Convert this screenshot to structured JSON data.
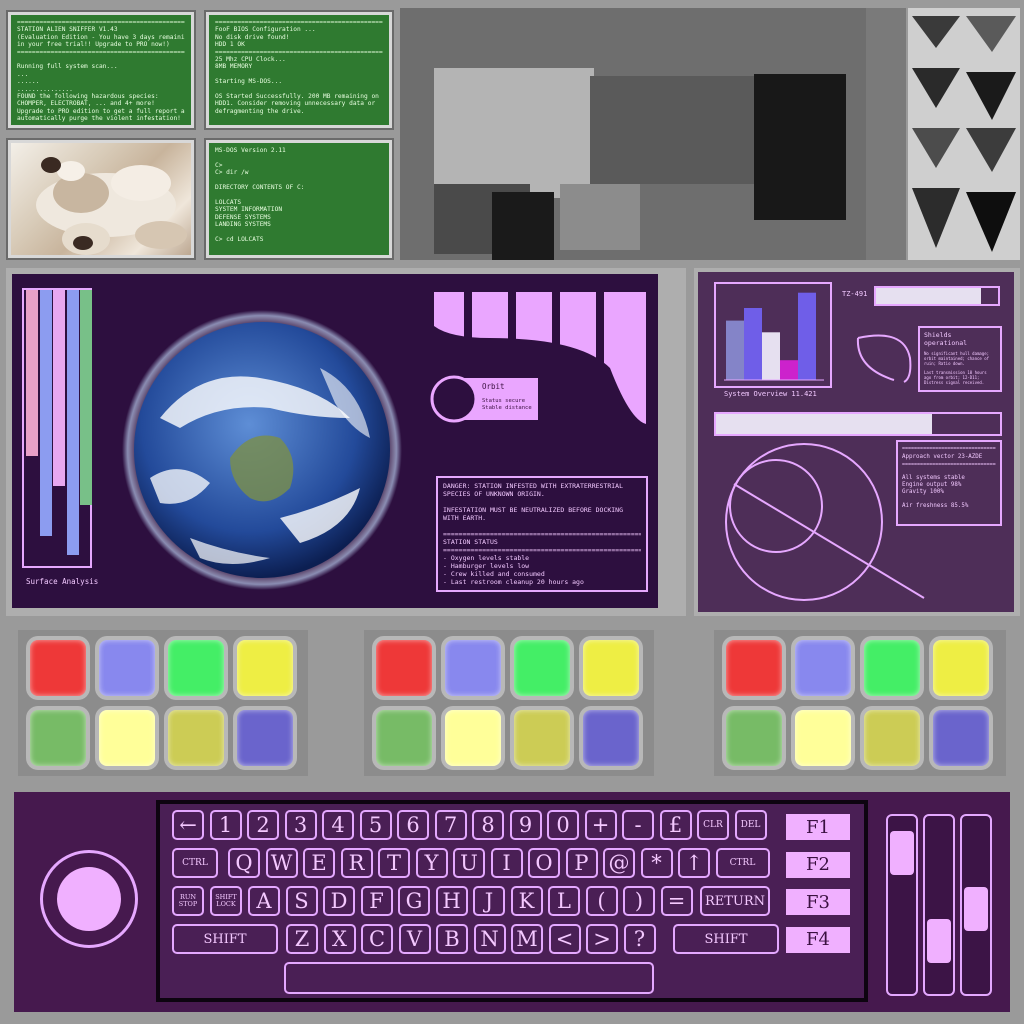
{
  "terminals": {
    "alien": {
      "lines": [
        "===================================================",
        "STATION ALIEN SNIFFER V1.43",
        "(Evaluation Edition - You have 3 days remaining",
        "in your free trial!! Upgrade to PRO now!)",
        "===================================================",
        "",
        "Running full system scan...",
        "...",
        "......",
        "...............",
        "FOUND the following hazardous species:",
        "CHOMPER, ELECTROBAT, ... and 4+ more!",
        "Upgrade to PRO edition to get a full report and",
        "automatically purge the violent infestation!"
      ]
    },
    "bios": {
      "lines": [
        "===================================================",
        "FooF BIOS Configuration ...",
        "No disk drive found!",
        "HDD 1 OK",
        "===================================================",
        "25 Mhz CPU Clock...",
        "8MB MEMORY",
        "",
        "Starting MS-DOS...",
        "",
        "OS Started Successfully. 200 MB remaining on",
        "HDD1. Consider removing unnecessary data or",
        "defragmenting the drive."
      ]
    },
    "dos": {
      "lines": [
        "MS-DOS Version 2.11",
        "",
        "C>",
        "C> dir /w",
        "",
        "DIRECTORY CONTENTS OF C:",
        "",
        "LOLCATS",
        "SYSTEM INFORMATION",
        "DEFENSE SYSTEMS",
        "LANDING SYSTEMS",
        "",
        "C> cd LOLCATS"
      ]
    }
  },
  "surface": {
    "label": "Surface Analysis",
    "bars": [
      {
        "color": "#e8a0c8",
        "level": 0.6
      },
      {
        "color": "#8c9cf0",
        "level": 0.89
      },
      {
        "color": "#e8a8f0",
        "level": 0.71
      },
      {
        "color": "#8c9cf0",
        "level": 0.96
      },
      {
        "color": "#78c088",
        "level": 0.78
      }
    ]
  },
  "orbit": {
    "title": "Orbit",
    "line1": "Status secure",
    "line2": "Stable distance"
  },
  "danger": {
    "line1": "DANGER: STATION INFESTED WITH EXTRATERRESTRIAL",
    "line2": "SPECIES OF UNKNOWN ORIGIN.",
    "line3": "INFESTATION MUST BE NEUTRALIZED BEFORE DOCKING",
    "line4": "WITH EARTH.",
    "sep": "===================================================",
    "status_title": "STATION STATUS",
    "items": [
      "- Oxygen levels stable",
      "- Hamburger levels low",
      "- Crew killed and consumed",
      "- Last restroom cleanup 20 hours ago"
    ]
  },
  "sidepanel": {
    "chart_caption": "System Overview 11.421",
    "tz_label": "TZ-491",
    "tz_level": 0.86,
    "wide_bar_level": 0.76,
    "shields_title": "Shields operational",
    "shields_text1": "No significant hull damage; orbit maintained; chance of ruin; Ratio down.",
    "shields_text2": "Last transmission 10 hours ago from orbit; 12-D11; Distress signal received.",
    "sep": "================================",
    "approach": "Approach vector 23-AZDE",
    "status_lines": [
      "All systems stable",
      "Engine output 98%",
      "Gravity 100%",
      "",
      "Air freshness 85.5%"
    ]
  },
  "overview_chart": {
    "type": "bar",
    "values": [
      0.66,
      0.8,
      0.53,
      0.22,
      0.97
    ],
    "colors": [
      "#8484c8",
      "#6f5ee8",
      "#e6e0f0",
      "#cc22cc",
      "#6f5ee8"
    ]
  },
  "pads": [
    {
      "colors": [
        "#ee3838",
        "#8888ee",
        "#44ee66",
        "#eeee44",
        "#77bb66",
        "#ffff99",
        "#cccc55",
        "#6a64cc"
      ]
    },
    {
      "colors": [
        "#ee3838",
        "#8888ee",
        "#44ee66",
        "#eeee44",
        "#77bb66",
        "#ffff99",
        "#cccc55",
        "#6a64cc"
      ]
    },
    {
      "colors": [
        "#ee3838",
        "#8888ee",
        "#44ee66",
        "#eeee44",
        "#77bb66",
        "#ffff99",
        "#cccc55",
        "#6a64cc"
      ]
    }
  ],
  "keyboard": {
    "row1": [
      "←",
      "1",
      "2",
      "3",
      "4",
      "5",
      "6",
      "7",
      "8",
      "9",
      "0",
      "+",
      "-",
      "£",
      "CLR",
      "DEL"
    ],
    "row2": [
      "CTRL",
      "Q",
      "W",
      "E",
      "R",
      "T",
      "Y",
      "U",
      "I",
      "O",
      "P",
      "@",
      "*",
      "↑",
      "CTRL"
    ],
    "row3": [
      "RUN STOP",
      "SHIFT LOCK",
      "A",
      "S",
      "D",
      "F",
      "G",
      "H",
      "J",
      "K",
      "L",
      "(",
      ")",
      "=",
      "RETURN"
    ],
    "row4": [
      "SHIFT",
      "Z",
      "X",
      "C",
      "V",
      "B",
      "N",
      "M",
      "<",
      ">",
      "?",
      "SHIFT"
    ],
    "fkeys": [
      "F1",
      "F2",
      "F3",
      "F4"
    ]
  },
  "sliders": [
    0.1,
    0.8,
    0.55
  ]
}
